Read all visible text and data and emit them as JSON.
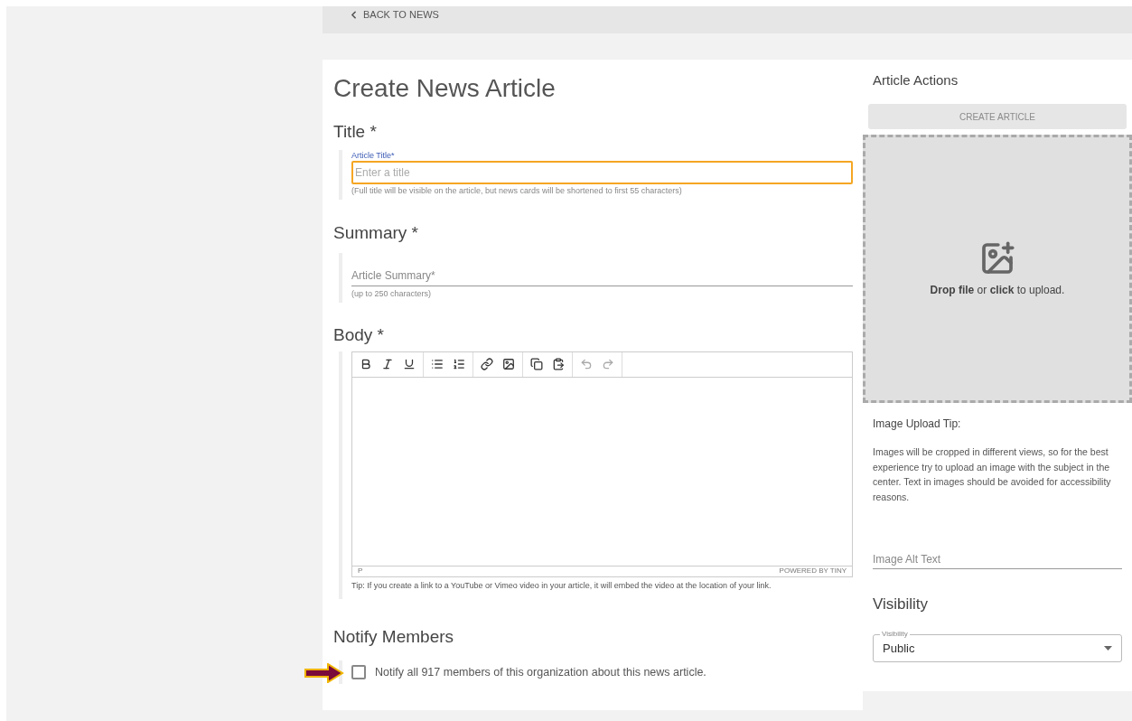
{
  "back_link": {
    "label": "BACK TO NEWS"
  },
  "page_title": "Create News Article",
  "title_section": {
    "heading": "Title *",
    "field_label": "Article Title*",
    "placeholder": "Enter a title",
    "focused": true,
    "helper": "(Full title will be visible on the article, but news cards will be shortened to first 55 characters)"
  },
  "summary_section": {
    "heading": "Summary *",
    "placeholder": "Article Summary*",
    "helper": "(up to 250 characters)"
  },
  "body_section": {
    "heading": "Body *",
    "toolbar_groups": [
      {
        "tools": [
          {
            "kind": "bold",
            "disabled": false
          },
          {
            "kind": "italic",
            "disabled": false
          },
          {
            "kind": "underline",
            "disabled": false
          }
        ]
      },
      {
        "tools": [
          {
            "kind": "bullet-list",
            "disabled": false
          },
          {
            "kind": "numbered-list",
            "disabled": false
          }
        ]
      },
      {
        "tools": [
          {
            "kind": "link",
            "disabled": false
          },
          {
            "kind": "image",
            "disabled": false
          }
        ]
      },
      {
        "tools": [
          {
            "kind": "copy",
            "disabled": false
          },
          {
            "kind": "paste",
            "disabled": false
          }
        ]
      },
      {
        "tools": [
          {
            "kind": "undo",
            "disabled": true
          },
          {
            "kind": "redo",
            "disabled": true
          }
        ]
      }
    ],
    "status_path": "P",
    "branding": "POWERED BY TINY",
    "tip": "Tip: If you create a link to a YouTube or Vimeo video in your article, it will embed the video at the location of your link."
  },
  "notify_section": {
    "heading": "Notify Members",
    "checkbox_label": "Notify all 917 members of this organization about this news article.",
    "checked": false
  },
  "sidebar": {
    "heading": "Article Actions",
    "create_button": {
      "label": "CREATE ARTICLE",
      "disabled": true
    },
    "dropzone_text": "**Drop file** or **click** to upload.",
    "tip_heading": "Image Upload Tip:",
    "tip_text": "Images will be cropped in different views, so for the best experience try to upload an image with the subject in the center. Text in images should be avoided for accessibility reasons.",
    "alt_text_placeholder": "Image Alt Text",
    "visibility_heading": "Visibility",
    "visibility_select": {
      "label": "Visibility",
      "value": "Public"
    }
  }
}
